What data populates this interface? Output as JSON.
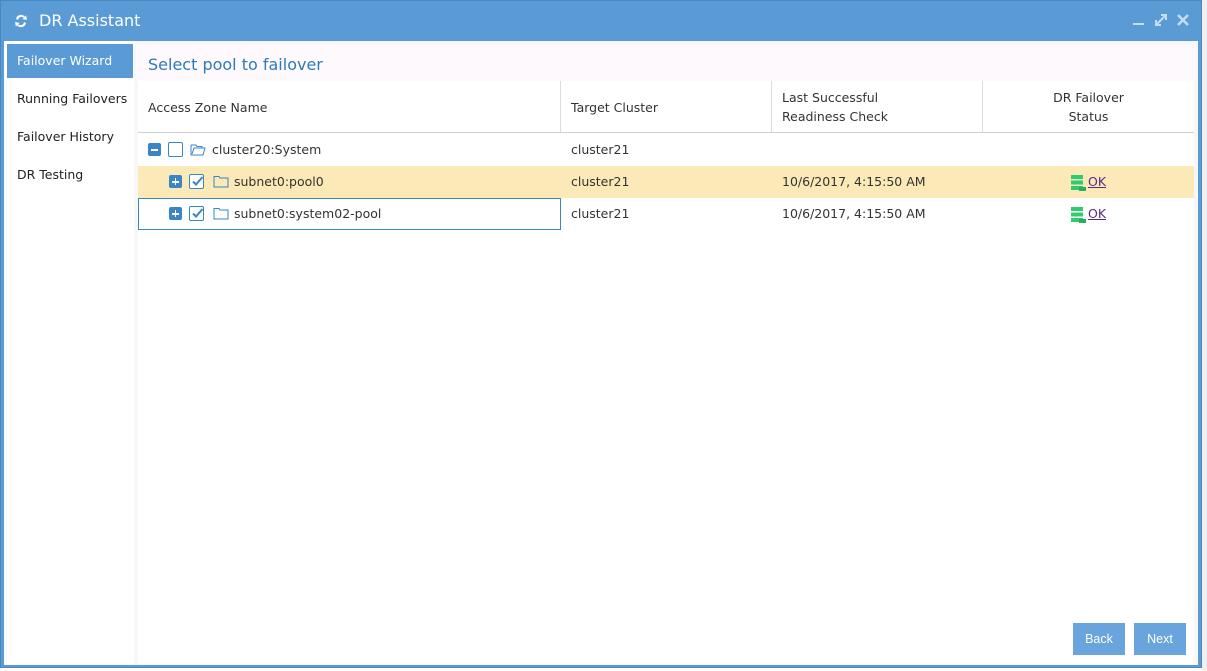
{
  "window": {
    "title": "DR Assistant",
    "accent": "#5b9bd5"
  },
  "sidebar": {
    "items": [
      {
        "label": "Failover Wizard",
        "active": true
      },
      {
        "label": "Running Failovers",
        "active": false
      },
      {
        "label": "Failover History",
        "active": false
      },
      {
        "label": "DR Testing",
        "active": false
      }
    ]
  },
  "main": {
    "page_title": "Select pool to failover",
    "columns": {
      "access_zone": "Access Zone Name",
      "target_cluster": "Target Cluster",
      "readiness_line1": "Last Successful",
      "readiness_line2": "Readiness Check",
      "status_line1": "DR Failover",
      "status_line2": "Status"
    },
    "rows": [
      {
        "name": "cluster20:System",
        "target": "cluster21",
        "readiness": "",
        "status": "",
        "expanded": true,
        "checked": false
      },
      {
        "name": "subnet0:pool0",
        "target": "cluster21",
        "readiness": "10/6/2017, 4:15:50 AM",
        "status": "OK",
        "expanded": false,
        "checked": true
      },
      {
        "name": "subnet0:system02-pool",
        "target": "cluster21",
        "readiness": "10/6/2017, 4:15:50 AM",
        "status": "OK",
        "expanded": false,
        "checked": true
      }
    ]
  },
  "buttons": {
    "back": "Back",
    "next": "Next"
  }
}
